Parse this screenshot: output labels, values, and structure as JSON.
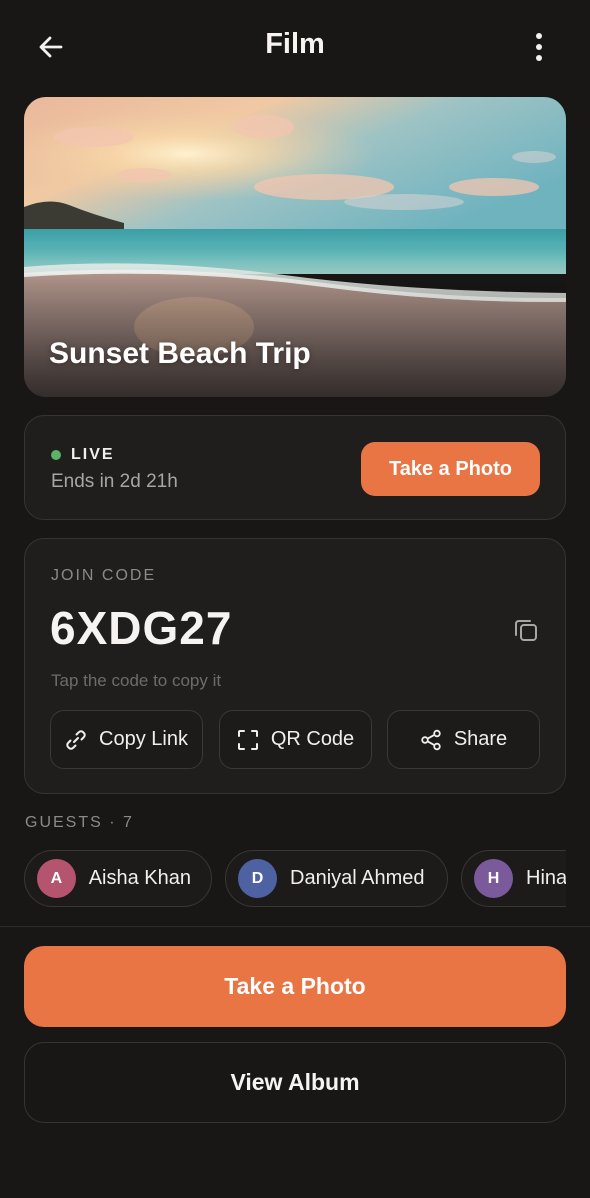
{
  "header": {
    "title": "Film",
    "back_icon": "arrow-left-icon",
    "more_icon": "more-vertical-icon"
  },
  "hero": {
    "title": "Sunset Beach Trip",
    "image": "sunset-beach-photo"
  },
  "status": {
    "live_label": "LIVE",
    "live_color": "#5bb36a",
    "ends_text": "Ends in 2d 21h",
    "take_photo_label": "Take a Photo"
  },
  "join": {
    "label": "JOIN CODE",
    "code": "6XDG27",
    "hint": "Tap the code to copy it",
    "actions": [
      {
        "label": "Copy Link",
        "icon": "link-icon"
      },
      {
        "label": "QR Code",
        "icon": "qr-scan-icon"
      },
      {
        "label": "Share",
        "icon": "share-icon"
      }
    ]
  },
  "guests": {
    "label": "GUESTS · 7",
    "items": [
      {
        "initial": "A",
        "name": "Aisha Khan",
        "color": "#b5546e"
      },
      {
        "initial": "D",
        "name": "Daniyal Ahmed",
        "color": "#4e62a3"
      },
      {
        "initial": "H",
        "name": "Hina",
        "color": "#7a5a9a"
      }
    ]
  },
  "bottom": {
    "take_photo_label": "Take a Photo",
    "view_album_label": "View Album"
  },
  "colors": {
    "accent": "#e87543",
    "background": "#181716",
    "card": "#1f1e1d"
  }
}
